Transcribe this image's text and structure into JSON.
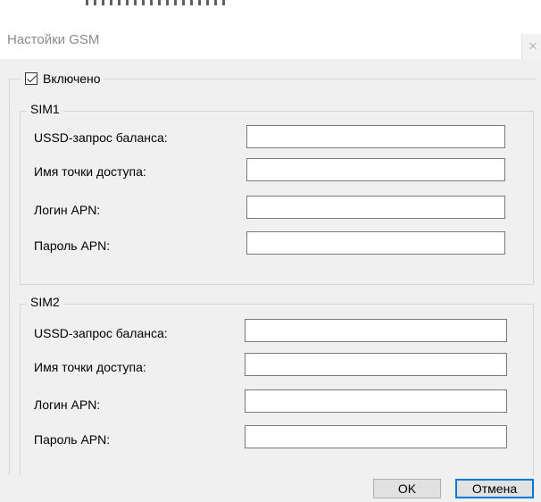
{
  "window": {
    "title": "Настойки GSM"
  },
  "enabled": {
    "label": "Включено",
    "checked": true
  },
  "sim1": {
    "legend": "SIM1",
    "fields": [
      {
        "label": "USSD-запрос баланса:",
        "value": ""
      },
      {
        "label": "Имя точки доступа:",
        "value": ""
      },
      {
        "label": "Логин APN:",
        "value": ""
      },
      {
        "label": "Пароль APN:",
        "value": ""
      }
    ]
  },
  "sim2": {
    "legend": "SIM2",
    "fields": [
      {
        "label": "USSD-запрос баланса:",
        "value": ""
      },
      {
        "label": "Имя точки доступа:",
        "value": ""
      },
      {
        "label": "Логин APN:",
        "value": ""
      },
      {
        "label": "Пароль APN:",
        "value": ""
      }
    ]
  },
  "buttons": {
    "ok": "OK",
    "cancel": "Отмена"
  }
}
